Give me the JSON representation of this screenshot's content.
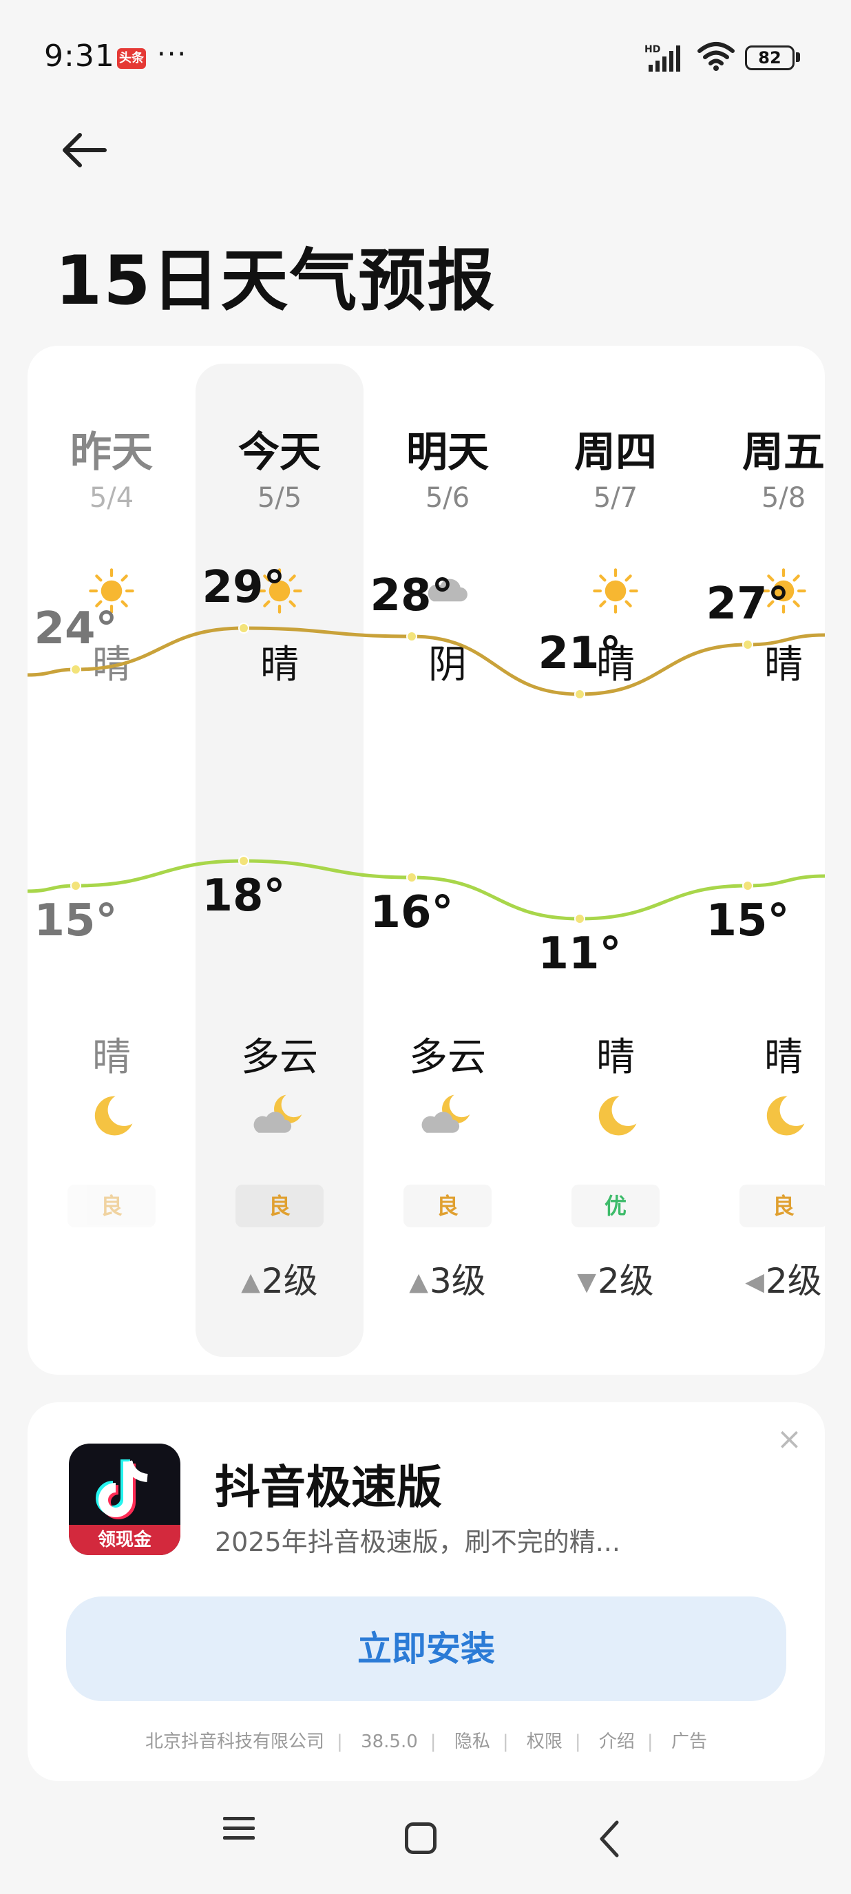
{
  "status": {
    "time": "9:31",
    "badge": "头条",
    "dots": "···",
    "hd": "HD",
    "battery": "82"
  },
  "title": "15日天气预报",
  "days": [
    {
      "day": "昨天",
      "date": "5/4",
      "day_cond": "晴",
      "day_icon": "sun-icon",
      "high": "24°",
      "low": "15°",
      "night_cond": "晴",
      "night_icon": "moon-icon",
      "aqi": "良",
      "aqi_color": "#e0a030",
      "wind_dir": "▲",
      "wind": "",
      "past": true
    },
    {
      "day": "今天",
      "date": "5/5",
      "day_cond": "晴",
      "day_icon": "sun-icon",
      "high": "29°",
      "low": "18°",
      "night_cond": "多云",
      "night_icon": "cloud-moon-icon",
      "aqi": "良",
      "aqi_color": "#e0a030",
      "wind_dir": "▲",
      "wind": "2级",
      "past": false
    },
    {
      "day": "明天",
      "date": "5/6",
      "day_cond": "阴",
      "day_icon": "cloud-icon",
      "high": "28°",
      "low": "16°",
      "night_cond": "多云",
      "night_icon": "cloud-moon-icon",
      "aqi": "良",
      "aqi_color": "#e0a030",
      "wind_dir": "▲",
      "wind": "3级",
      "past": false
    },
    {
      "day": "周四",
      "date": "5/7",
      "day_cond": "晴",
      "day_icon": "sun-icon",
      "high": "21°",
      "low": "11°",
      "night_cond": "晴",
      "night_icon": "moon-icon",
      "aqi": "优",
      "aqi_color": "#3dbb6a",
      "wind_dir": "▼",
      "wind": "2级",
      "past": false
    },
    {
      "day": "周五",
      "date": "5/8",
      "day_cond": "晴",
      "day_icon": "sun-icon",
      "high": "27°",
      "low": "15°",
      "night_cond": "晴",
      "night_icon": "moon-icon",
      "aqi": "良",
      "aqi_color": "#e0a030",
      "wind_dir": "◀",
      "wind": "2级",
      "past": false
    }
  ],
  "colors": {
    "high_line": "#c9a23a",
    "low_line": "#a8d64a",
    "sun": "#f7b731",
    "moon": "#f5c342",
    "cloud": "#b9b9b9"
  },
  "ad": {
    "name": "抖音极速版",
    "badge": "领现金",
    "desc": "2025年抖音极速版，刷不完的精...",
    "button": "立即安装",
    "close": "×",
    "footer": [
      "北京抖音科技有限公司",
      "38.5.0",
      "隐私",
      "权限",
      "介绍",
      "广告"
    ]
  }
}
